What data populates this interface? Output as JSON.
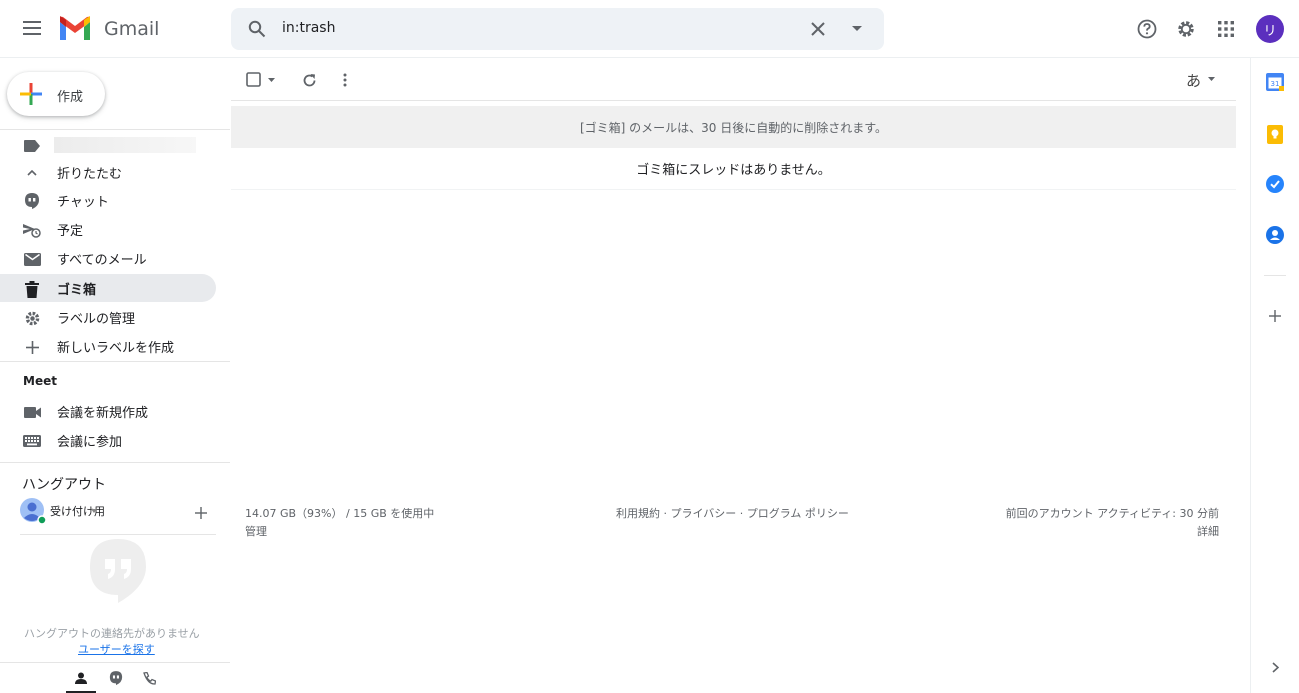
{
  "header": {
    "app_name": "Gmail",
    "search_value": "in:trash",
    "avatar_letter": "リ"
  },
  "compose": {
    "label": "作成"
  },
  "nav": {
    "collapse": "折りたたむ",
    "chat": "チャット",
    "scheduled": "予定",
    "all_mail": "すべてのメール",
    "trash": "ゴミ箱",
    "manage_labels": "ラベルの管理",
    "new_label": "新しいラベルを作成"
  },
  "meet": {
    "title": "Meet",
    "new_meeting": "会議を新規作成",
    "join_meeting": "会議に参加"
  },
  "hangouts": {
    "title": "ハングアウト",
    "status": "受け付け用",
    "no_contacts": "ハングアウトの連絡先がありません",
    "find_user": "ユーザーを探す"
  },
  "main": {
    "input_method": "あ",
    "trash_notice": "[ゴミ箱] のメールは、30 日後に自動的に削除されます。",
    "empty_message": "ゴミ箱にスレッドはありません。"
  },
  "footer": {
    "storage": "14.07 GB（93%） / 15 GB を使用中",
    "manage": "管理",
    "links": "利用規約 · プライバシー · プログラム ポリシー",
    "activity": "前回のアカウント アクティビティ: 30 分前",
    "details": "詳細"
  },
  "colors": {
    "active_bg": "#e8eaed",
    "search_bg": "#eef2f6",
    "avatar": "#5b2fbe",
    "link": "#1a73e8"
  }
}
